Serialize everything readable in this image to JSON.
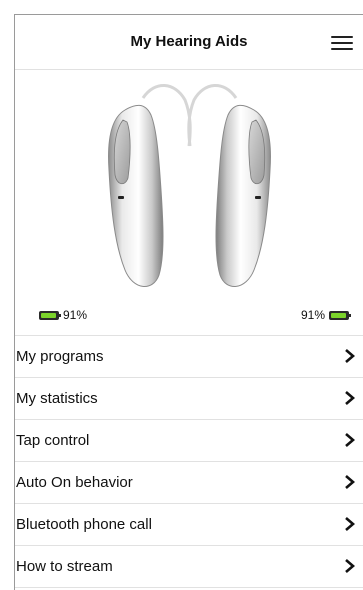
{
  "header": {
    "title": "My Hearing Aids",
    "menu_icon": "hamburger-menu-icon"
  },
  "hero": {
    "image": "hearing-aids-pair"
  },
  "battery": {
    "left_percent": "91%",
    "right_percent": "91%",
    "level": 0.91,
    "color": "#7bd32a"
  },
  "menu": [
    {
      "label": "My programs",
      "icon": "chevron-right-icon"
    },
    {
      "label": "My statistics",
      "icon": "chevron-right-icon"
    },
    {
      "label": "Tap control",
      "icon": "chevron-right-icon"
    },
    {
      "label": "Auto On behavior",
      "icon": "chevron-right-icon"
    },
    {
      "label": "Bluetooth phone call",
      "icon": "chevron-right-icon"
    },
    {
      "label": "How to stream",
      "icon": "chevron-right-icon"
    }
  ]
}
